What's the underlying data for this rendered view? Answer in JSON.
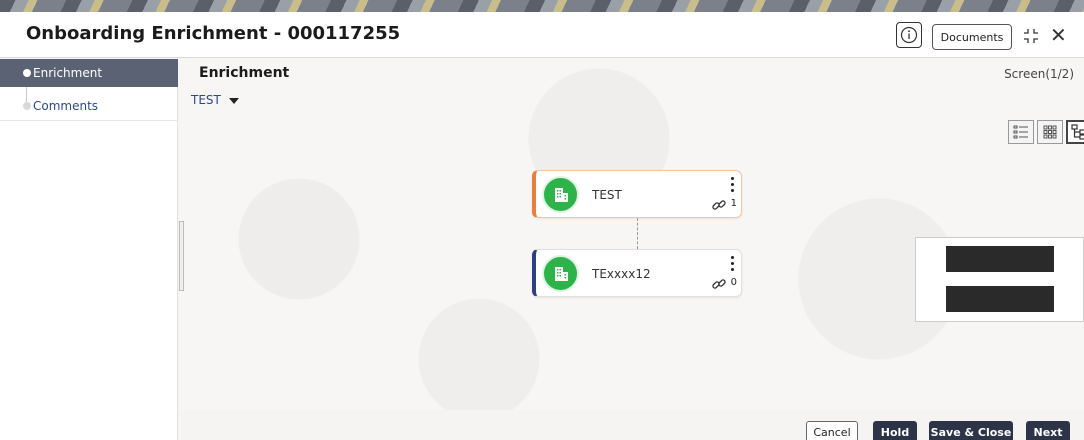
{
  "header": {
    "title": "Onboarding Enrichment - 000117255",
    "documents_label": "Documents",
    "info_icon": "info-icon",
    "expand_icon": "expand-icon",
    "close_glyph": "✕"
  },
  "sidebar": {
    "items": [
      {
        "label": "Enrichment",
        "active": true
      },
      {
        "label": "Comments",
        "active": false
      }
    ]
  },
  "main": {
    "title": "Enrichment",
    "screen_indicator": "Screen(1/2)",
    "dropdown_value": "TEST",
    "view_modes": [
      "list-view-icon",
      "grid-view-icon",
      "tree-view-icon"
    ],
    "nodes": [
      {
        "label": "TEST",
        "link_count": "1",
        "accent": "#ef7d3a"
      },
      {
        "label": "TExxxx12",
        "link_count": "0",
        "accent": "#2e3f8a"
      }
    ]
  },
  "footer": {
    "cancel": "Cancel",
    "hold": "Hold",
    "save_close": "Save & Close",
    "next": "Next"
  },
  "colors": {
    "primary_button": "#2d3448",
    "active_sidebar": "#5a6274",
    "node_avatar": "#2db34a"
  }
}
